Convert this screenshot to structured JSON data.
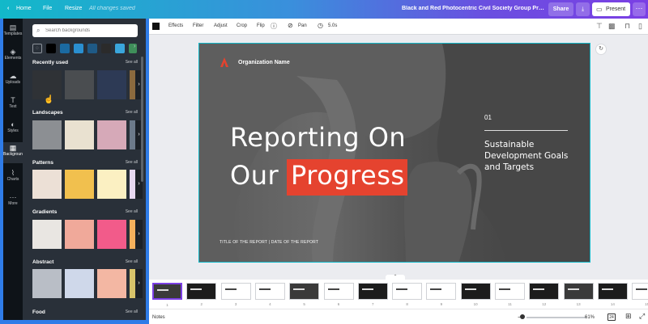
{
  "topbar": {
    "home": "Home",
    "file": "File",
    "resize": "Resize",
    "saved": "All changes saved",
    "doc_title": "Black and Red Photocentric Civil Society Group Progress Re...",
    "share": "Share",
    "present": "Present"
  },
  "rail": {
    "items": [
      {
        "label": "Templates",
        "icon": "template-icon"
      },
      {
        "label": "Elements",
        "icon": "elements-icon"
      },
      {
        "label": "Uploads",
        "icon": "upload-icon"
      },
      {
        "label": "Text",
        "icon": "text-icon"
      },
      {
        "label": "Styles",
        "icon": "styles-icon"
      },
      {
        "label": "Background",
        "icon": "background-icon"
      },
      {
        "label": "Charts",
        "icon": "charts-icon"
      },
      {
        "label": "More",
        "icon": "more-icon"
      }
    ]
  },
  "panel": {
    "search_placeholder": "Search backgrounds",
    "swatch_colors": [
      "#000000",
      "#1b6aa1",
      "#2a8fd0",
      "#1f5a86",
      "#2b2b2b",
      "#3aa6dc",
      "#3f8f5a"
    ],
    "sections": [
      {
        "title": "Recently used",
        "see_all": "See all",
        "colors": [
          "#2f3236",
          "#4a4d50",
          "#2d3a55",
          "#8b6a3e"
        ]
      },
      {
        "title": "Landscapes",
        "see_all": "See all",
        "colors": [
          "#8c8f93",
          "#e9e1d0",
          "#d6a9b8",
          "#6c7a8a"
        ]
      },
      {
        "title": "Patterns",
        "see_all": "See all",
        "colors": [
          "#ece0d6",
          "#f1c04e",
          "#fbf0c2",
          "#e7d8f0"
        ]
      },
      {
        "title": "Gradients",
        "see_all": "See all",
        "colors": [
          "#e9e6e2",
          "#f0a99a",
          "#f25b8a",
          "#f5b15c"
        ]
      },
      {
        "title": "Abstract",
        "see_all": "See all",
        "colors": [
          "#b9bec6",
          "#cfd8ea",
          "#f3b7a3",
          "#d7c36a"
        ]
      },
      {
        "title": "Food",
        "see_all": "See all",
        "colors": []
      }
    ]
  },
  "toolbar": {
    "effects": "Effects",
    "filter": "Filter",
    "adjust": "Adjust",
    "crop": "Crop",
    "flip": "Flip",
    "pan": "Pan",
    "duration": "5.0s"
  },
  "slide": {
    "org": "Organization Name",
    "title_line1": "Reporting On",
    "title_line2": "Our",
    "title_highlight": "Progress",
    "number": "01",
    "side_line1": "Sustainable",
    "side_line2": "Development Goals",
    "side_line3": "and Targets",
    "footer": "TITLE OF THE REPORT  |  DATE OF THE REPORT",
    "accent": "#e5432f"
  },
  "pages": [
    "1",
    "2",
    "3",
    "4",
    "5",
    "6",
    "7",
    "8",
    "9",
    "10",
    "11",
    "12",
    "13",
    "14",
    "15"
  ],
  "footer": {
    "notes": "Notes",
    "zoom": "61%",
    "page_count": "24",
    "zoom_fraction": 0.61
  }
}
